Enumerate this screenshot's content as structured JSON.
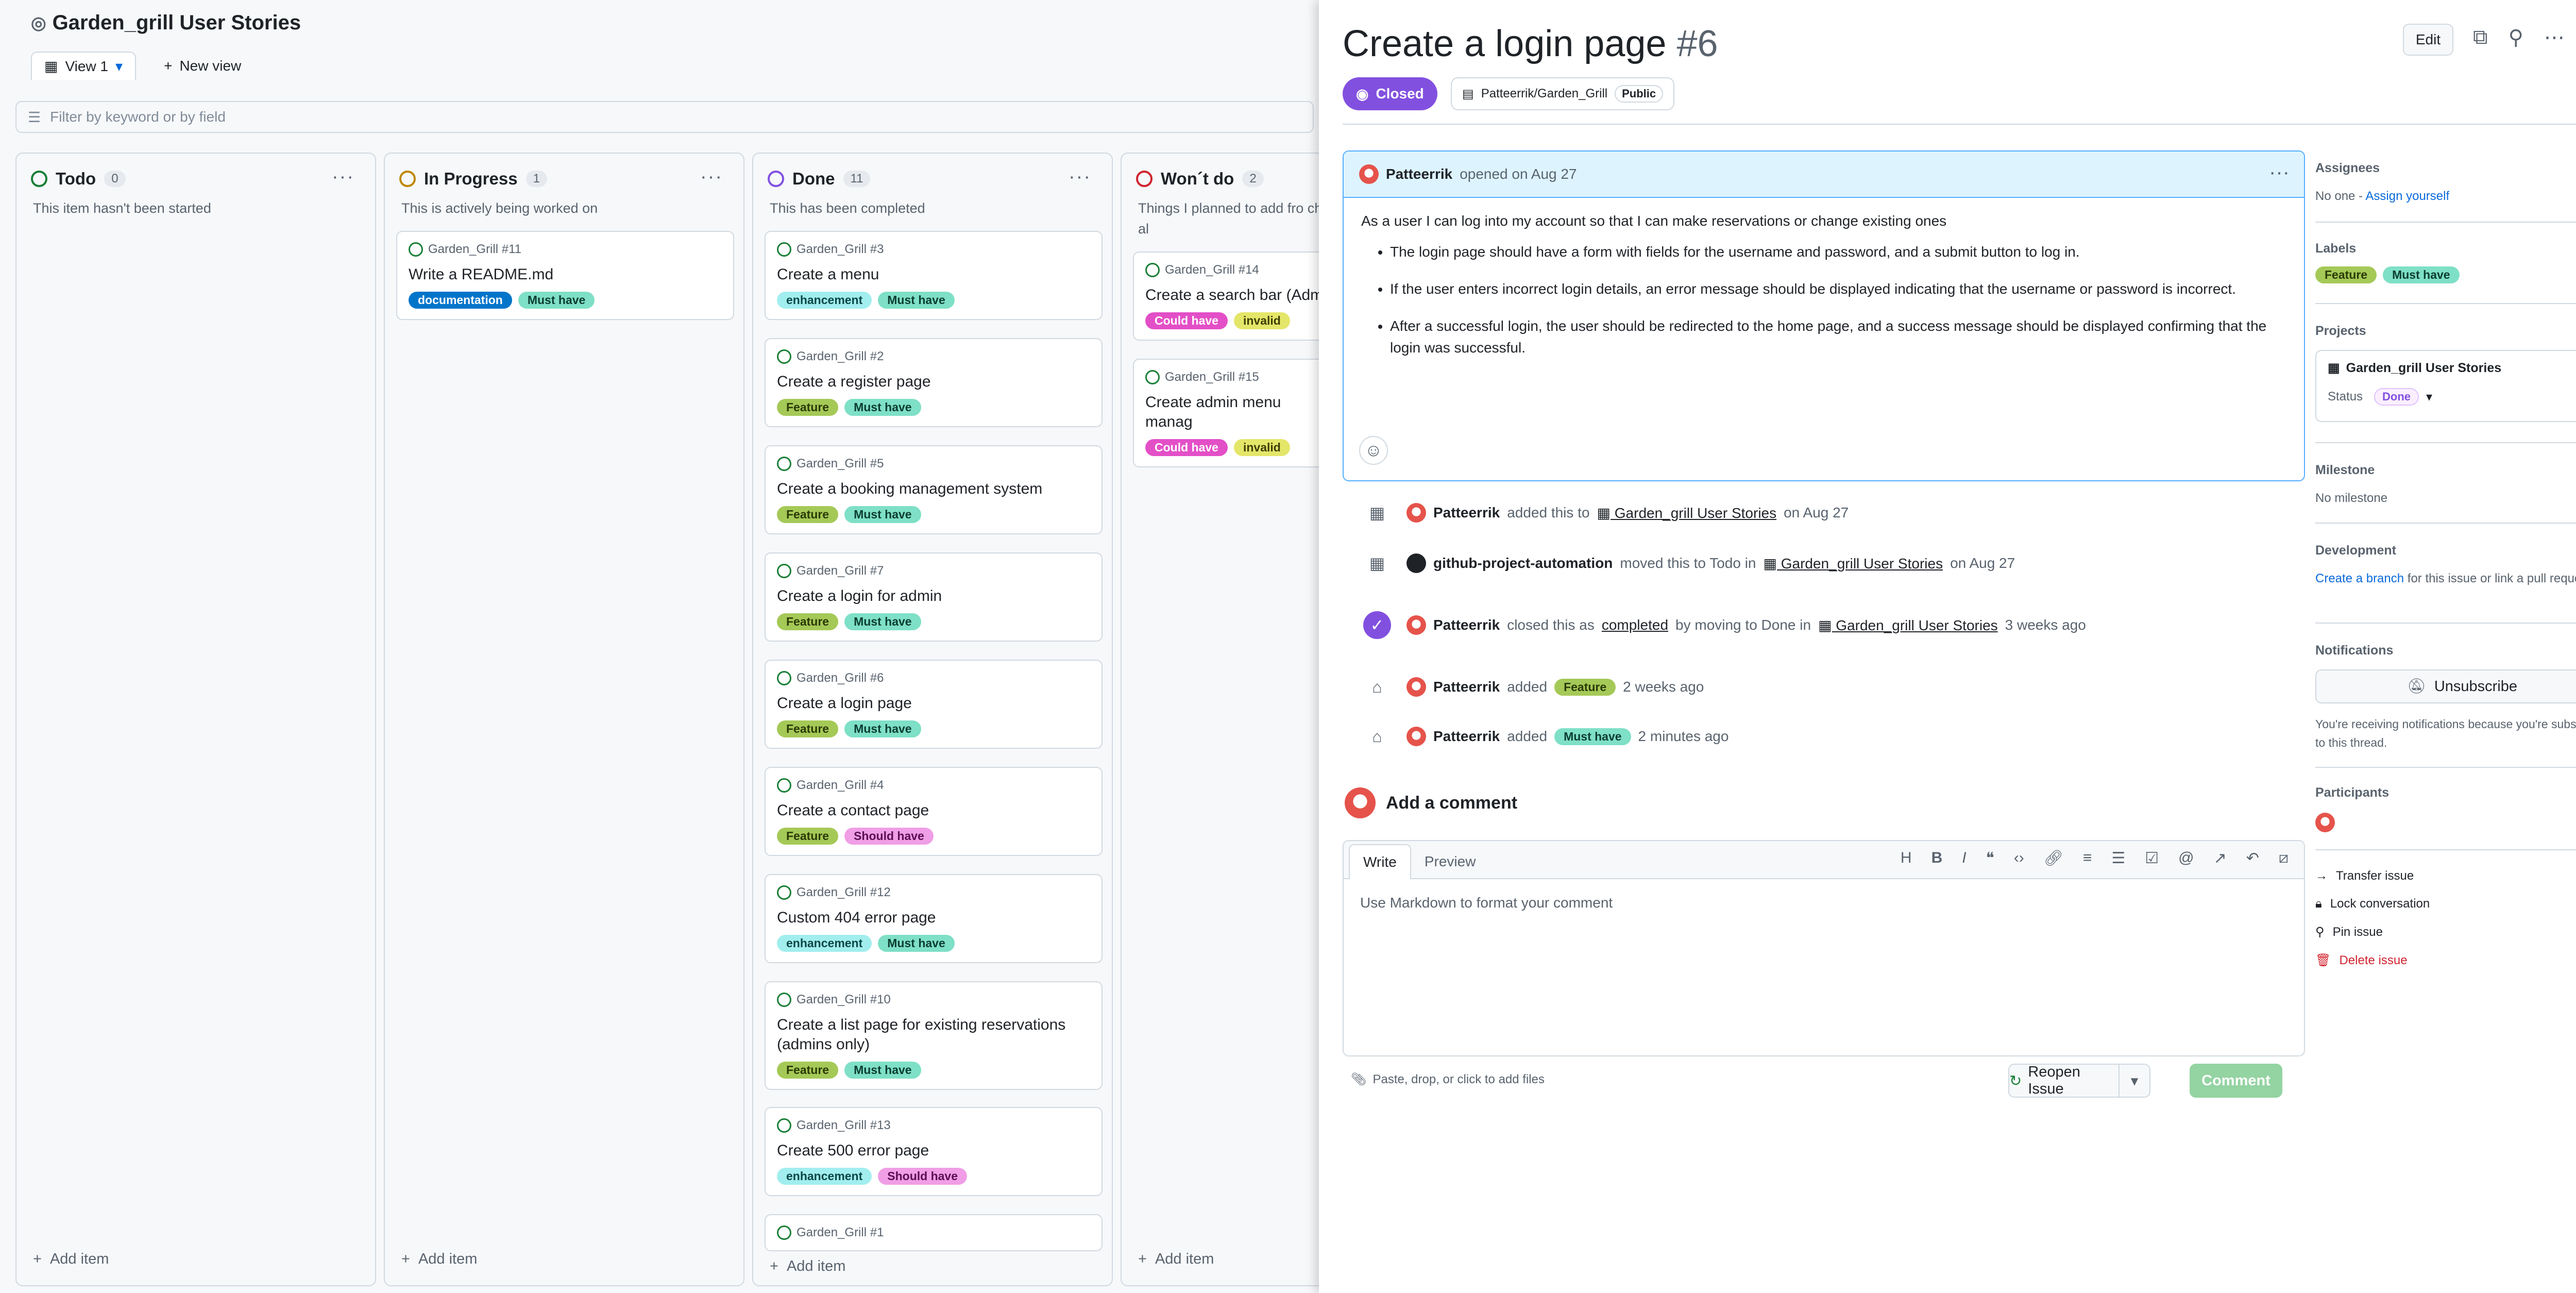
{
  "project": {
    "title": "Garden_grill User Stories"
  },
  "views": {
    "active": "View 1",
    "new_view": "New view"
  },
  "filter": {
    "placeholder": "Filter by keyword or by field"
  },
  "columns": [
    {
      "name": "Todo",
      "count": "0",
      "desc": "This item hasn't been started",
      "color": "#1a7f37",
      "add": "Add item"
    },
    {
      "name": "In Progress",
      "count": "1",
      "desc": "This is actively being worked on",
      "color": "#bf8700",
      "add": "Add item"
    },
    {
      "name": "Done",
      "count": "11",
      "desc": "This has been completed",
      "color": "#8250df",
      "add": "Add item"
    },
    {
      "name": "Won´t do",
      "count": "2",
      "desc": "Things I planned to add fro changed my mind about al",
      "color": "#d1242f",
      "add": "Add item"
    }
  ],
  "cards": {
    "in_progress": [
      {
        "ref": "Garden_Grill #11",
        "title": "Write a README.md",
        "labels": [
          "documentation",
          "Must have"
        ]
      }
    ],
    "done": [
      {
        "ref": "Garden_Grill #3",
        "title": "Create a menu",
        "labels": [
          "enhancement",
          "Must have"
        ]
      },
      {
        "ref": "Garden_Grill #2",
        "title": "Create a register page",
        "labels": [
          "Feature",
          "Must have"
        ]
      },
      {
        "ref": "Garden_Grill #5",
        "title": "Create a booking management system",
        "labels": [
          "Feature",
          "Must have"
        ]
      },
      {
        "ref": "Garden_Grill #7",
        "title": "Create a login for admin",
        "labels": [
          "Feature",
          "Must have"
        ]
      },
      {
        "ref": "Garden_Grill #6",
        "title": "Create a login page",
        "labels": [
          "Feature",
          "Must have"
        ]
      },
      {
        "ref": "Garden_Grill #4",
        "title": "Create a contact page",
        "labels": [
          "Feature",
          "Should have"
        ]
      },
      {
        "ref": "Garden_Grill #12",
        "title": "Custom 404 error page",
        "labels": [
          "enhancement",
          "Must have"
        ]
      },
      {
        "ref": "Garden_Grill #10",
        "title": "Create a list page for existing reservations (admins only)",
        "labels": [
          "Feature",
          "Must have"
        ]
      },
      {
        "ref": "Garden_Grill #13",
        "title": "Create 500 error page",
        "labels": [
          "enhancement",
          "Should have"
        ]
      },
      {
        "ref": "Garden_Grill #1",
        "title": "",
        "labels": []
      }
    ],
    "wont_do": [
      {
        "ref": "Garden_Grill #14",
        "title": "Create a search bar (Admi",
        "labels": [
          "Could have",
          "invalid"
        ]
      },
      {
        "ref": "Garden_Grill #15",
        "title": "Create admin menu manag",
        "labels": [
          "Could have",
          "invalid"
        ]
      }
    ]
  },
  "label_colors": {
    "documentation": {
      "bg": "#0075ca",
      "fg": "#ffffff"
    },
    "Must have": {
      "bg": "#7ee0c6",
      "fg": "#0b3d30"
    },
    "enhancement": {
      "bg": "#a2eeef",
      "fg": "#0b4748"
    },
    "Feature": {
      "bg": "#a5c957",
      "fg": "#2a3a06"
    },
    "Should have": {
      "bg": "#f09ee6",
      "fg": "#5a0f52"
    },
    "Could have": {
      "bg": "#e34fc7",
      "fg": "#ffffff"
    },
    "invalid": {
      "bg": "#e4e669",
      "fg": "#3d3e05"
    }
  },
  "issue": {
    "title": "Create a login page",
    "number": "#6",
    "edit": "Edit",
    "state": "Closed",
    "repo": "Patteerrik/Garden_Grill",
    "visibility": "Public",
    "author": "Patteerrik",
    "opened": "opened on Aug 27",
    "body": {
      "p1": "As a user I can log into my account so that I can make reservations or change existing ones",
      "bullets": [
        "The login page should have a form with fields for the username and password, and a submit button to log in.",
        "If the user enters incorrect login details, an error message should be displayed indicating that the username or password is incorrect.",
        "After a successful login, the user should be redirected to the home page, and a success message should be displayed confirming that the login was successful."
      ]
    }
  },
  "timeline": [
    {
      "actor": "Patteerrik",
      "pre": "added this to",
      "link": "Garden_grill User Stories",
      "post": "on Aug 27"
    },
    {
      "actor": "github-project-automation",
      "pre": "moved this to Todo in",
      "link": "Garden_grill User Stories",
      "post": "on Aug 27"
    },
    {
      "actor": "Patteerrik",
      "pre": "closed this as",
      "completed": "completed",
      "mid": "by moving to Done in",
      "link": "Garden_grill User Stories",
      "post": "3 weeks ago"
    },
    {
      "actor": "Patteerrik",
      "pre": "added",
      "label": "Feature",
      "post": "2 weeks ago"
    },
    {
      "actor": "Patteerrik",
      "pre": "added",
      "label": "Must have",
      "post": "2 minutes ago"
    }
  ],
  "comment": {
    "heading": "Add a comment",
    "tab_write": "Write",
    "tab_preview": "Preview",
    "placeholder": "Use Markdown to format your comment",
    "attach": "Paste, drop, or click to add files",
    "reopen": "Reopen Issue",
    "submit": "Comment"
  },
  "sidebar": {
    "assignees": {
      "title": "Assignees",
      "value": "No one - ",
      "link": "Assign yourself"
    },
    "labels": {
      "title": "Labels",
      "items": [
        "Feature",
        "Must have"
      ]
    },
    "projects": {
      "title": "Projects",
      "project": "Garden_grill User Stories",
      "status_label": "Status",
      "status": "Done"
    },
    "milestone": {
      "title": "Milestone",
      "value": "No milestone"
    },
    "development": {
      "title": "Development",
      "link": "Create a branch",
      "text": " for this issue or link a pull request."
    },
    "notifications": {
      "title": "Notifications",
      "button": "Unsubscribe",
      "text": "You're receiving notifications because you're subscribed to this thread."
    },
    "participants": {
      "title": "Participants"
    },
    "actions": [
      "Transfer issue",
      "Lock conversation",
      "Pin issue",
      "Delete issue"
    ]
  }
}
